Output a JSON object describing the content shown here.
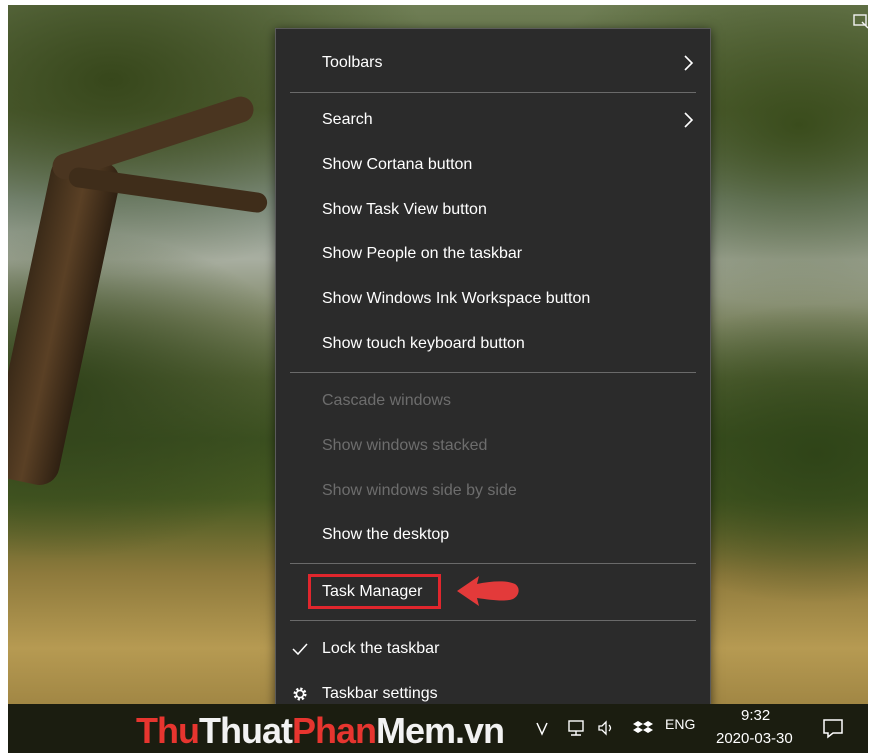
{
  "menu": {
    "toolbars": "Toolbars",
    "search": "Search",
    "show_cortana": "Show Cortana button",
    "show_task_view": "Show Task View button",
    "show_people": "Show People on the taskbar",
    "show_ink": "Show Windows Ink Workspace button",
    "show_touch_keyboard": "Show touch keyboard button",
    "cascade": "Cascade windows",
    "stacked": "Show windows stacked",
    "side_by_side": "Show windows side by side",
    "show_desktop": "Show the desktop",
    "task_manager": "Task Manager",
    "lock_taskbar": "Lock the taskbar",
    "taskbar_settings": "Taskbar settings"
  },
  "taskbar": {
    "watermark": {
      "part1": "Thu",
      "part2": "Thuat",
      "part3": "Phan",
      "part4": "Mem.vn"
    },
    "lang": "ENG",
    "time": "9:32",
    "date": "2020-03-30"
  },
  "colors": {
    "menu_bg": "#2b2b2b",
    "highlight": "#e0262d",
    "disabled_text": "#6d6d6d"
  },
  "icons": [
    "chevron-right-icon",
    "checkmark-icon",
    "gear-icon",
    "arrow-pointer-icon",
    "wifi-icon",
    "network-icon",
    "speaker-icon",
    "dropbox-icon",
    "notification-icon"
  ]
}
